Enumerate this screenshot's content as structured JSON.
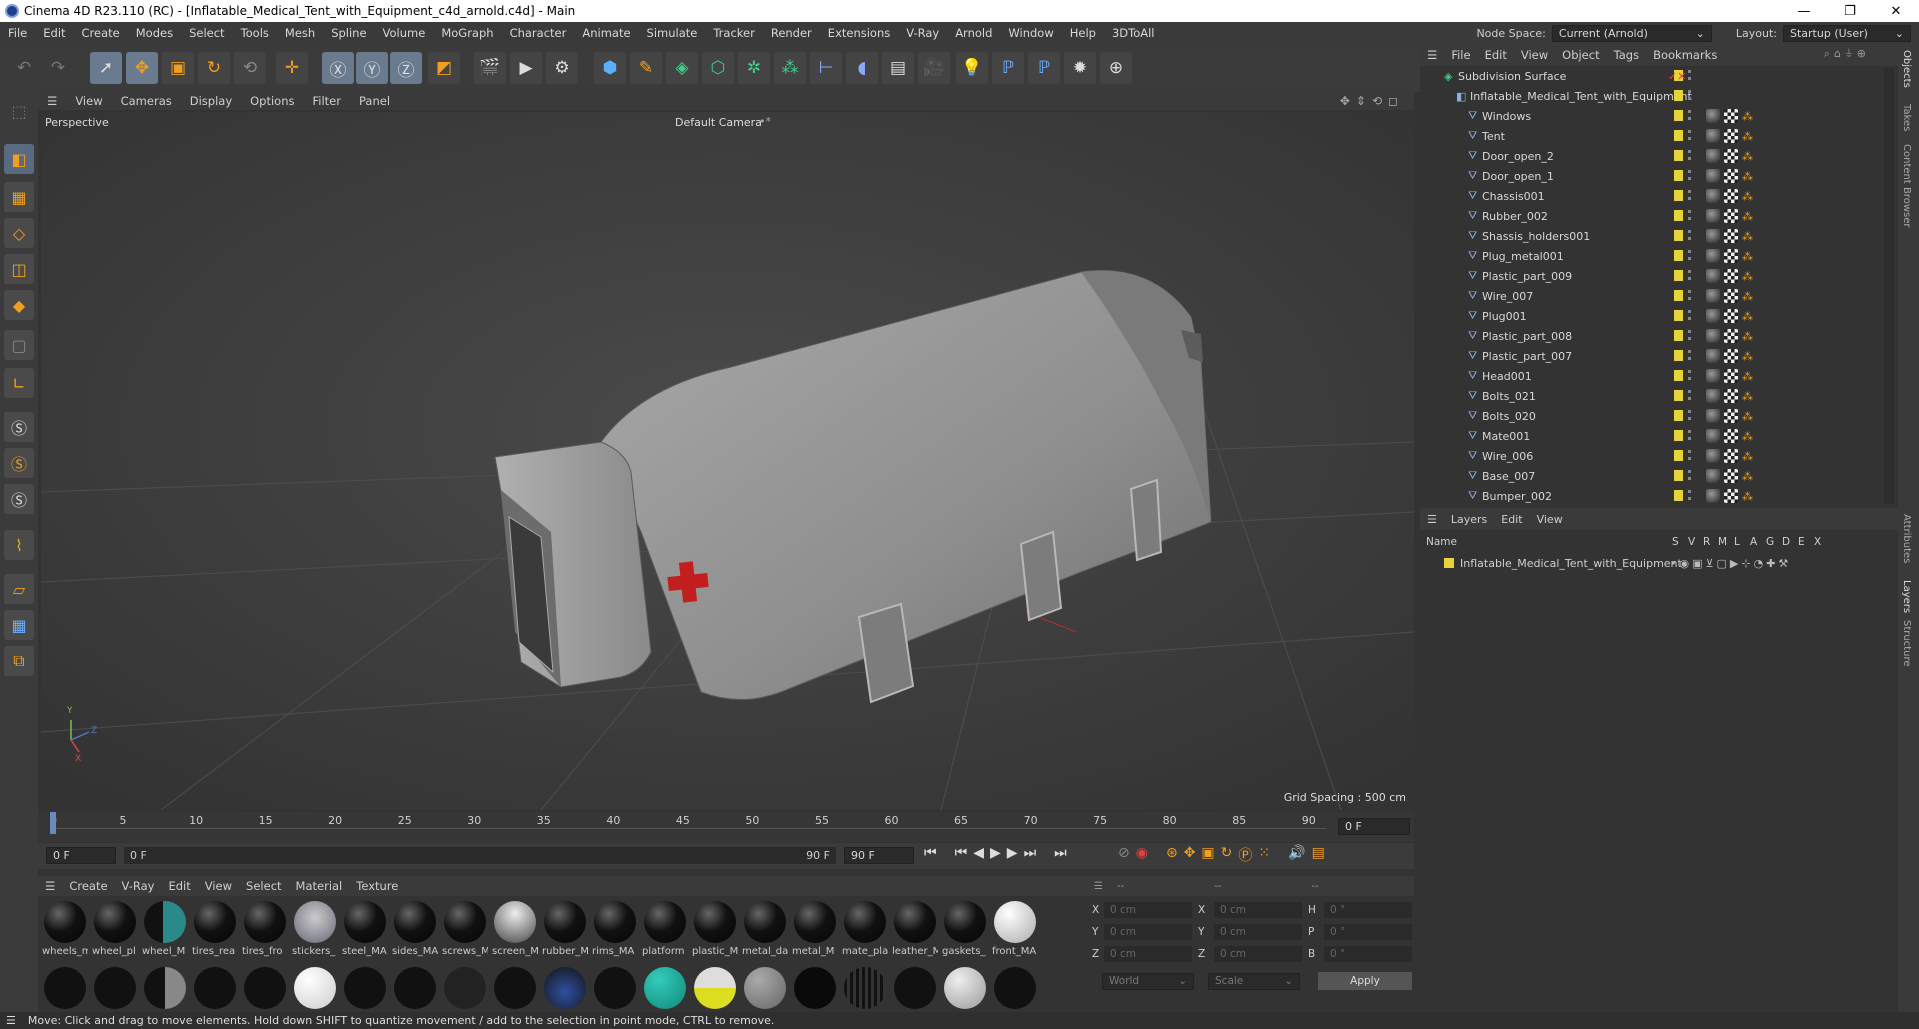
{
  "window": {
    "title": "Cinema 4D R23.110 (RC) - [Inflatable_Medical_Tent_with_Equipment_c4d_arnold.c4d] - Main",
    "minimize": "—",
    "maximize": "❐",
    "close": "✕"
  },
  "menubar": {
    "items": [
      "File",
      "Edit",
      "Create",
      "Modes",
      "Select",
      "Tools",
      "Mesh",
      "Spline",
      "Volume",
      "MoGraph",
      "Character",
      "Animate",
      "Simulate",
      "Tracker",
      "Render",
      "Extensions",
      "V-Ray",
      "Arnold",
      "Window",
      "Help",
      "3DToAll"
    ],
    "node_space_label": "Node Space:",
    "node_space_value": "Current (Arnold)",
    "layout_label": "Layout:",
    "layout_value": "Startup (User)"
  },
  "viewport": {
    "menu": [
      "View",
      "Cameras",
      "Display",
      "Options",
      "Filter",
      "Panel"
    ],
    "name": "Perspective",
    "camera": "Default Camera",
    "camera_icon": "•*",
    "grid_spacing": "Grid Spacing : 500 cm",
    "axis_x": "X",
    "axis_y": "Y",
    "axis_z": "Z"
  },
  "timeline": {
    "ticks": [
      "0",
      "5",
      "10",
      "15",
      "20",
      "25",
      "30",
      "35",
      "40",
      "45",
      "50",
      "55",
      "60",
      "65",
      "70",
      "75",
      "80",
      "85",
      "90"
    ],
    "current_frame": "0 F",
    "start_field": "0 F",
    "range_start": "0 F",
    "range_end": "90 F",
    "end_field": "90 F",
    "end_field2": "90 F"
  },
  "materials": {
    "menu": [
      "Create",
      "V-Ray",
      "Edit",
      "View",
      "Select",
      "Material",
      "Texture"
    ],
    "row1": [
      "wheels_m",
      "wheel_pl",
      "wheel_M",
      "tires_rea",
      "tires_fro",
      "stickers_",
      "steel_MA",
      "sides_MA",
      "screws_M",
      "screen_M",
      "rubber_M",
      "rims_MA",
      "platform",
      "plastic_M",
      "metal_da",
      "metal_M",
      "mate_pla",
      "leather_M",
      "gaskets_",
      "front_MA"
    ],
    "row2_count": 20
  },
  "coords": {
    "header": [
      "--",
      "--",
      "--"
    ],
    "rows": [
      {
        "a": "X",
        "av": "0 cm",
        "b": "X",
        "bv": "0 cm",
        "c": "H",
        "cv": "0 °"
      },
      {
        "a": "Y",
        "av": "0 cm",
        "b": "Y",
        "bv": "0 cm",
        "c": "P",
        "cv": "0 °"
      },
      {
        "a": "Z",
        "av": "0 cm",
        "b": "Z",
        "bv": "0 cm",
        "c": "B",
        "cv": "0 °"
      }
    ],
    "world": "World",
    "scale": "Scale",
    "apply": "Apply"
  },
  "objects": {
    "menu": [
      "File",
      "Edit",
      "View",
      "Object",
      "Tags",
      "Bookmarks"
    ],
    "root": "Subdivision Surface",
    "group": "Inflatable_Medical_Tent_with_Equipment",
    "items": [
      "Windows",
      "Tent",
      "Door_open_2",
      "Door_open_1",
      "Chassis001",
      "Rubber_002",
      "Shassis_holders001",
      "Plug_metal001",
      "Plastic_part_009",
      "Wire_007",
      "Plug001",
      "Plastic_part_008",
      "Plastic_part_007",
      "Head001",
      "Bolts_021",
      "Bolts_020",
      "Mate001",
      "Wire_006",
      "Base_007",
      "Bumper_002"
    ]
  },
  "layers": {
    "menu": [
      "Layers",
      "Edit",
      "View"
    ],
    "col_name": "Name",
    "cols": [
      "S",
      "V",
      "R",
      "M",
      "L",
      "A",
      "G",
      "D",
      "E",
      "X"
    ],
    "layer_name": "Inflatable_Medical_Tent_with_Equipment"
  },
  "right_tabs": [
    "Objects",
    "Takes",
    "Content Browser",
    "Attributes",
    "Layers",
    "Structure"
  ],
  "status": "Move: Click and drag to move elements. Hold down SHIFT to quantize movement / add to the selection in point mode, CTRL to remove.",
  "colors": {
    "accent": "#e8d33a",
    "selected_tool": "#6a7a8f",
    "background": "#333333"
  }
}
